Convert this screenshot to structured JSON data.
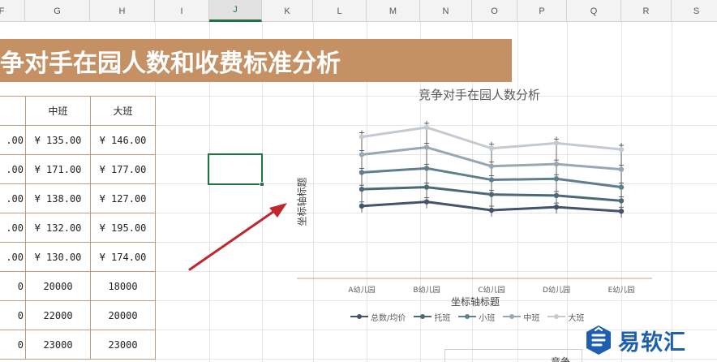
{
  "columns": [
    "F",
    "G",
    "H",
    "I",
    "J",
    "K",
    "L",
    "M",
    "N",
    "O",
    "P",
    "Q",
    "R",
    "S"
  ],
  "selected_column": "J",
  "banner_title": "争对手在园人数和收费标准分析",
  "table": {
    "headers": [
      "",
      "中班",
      "大班"
    ],
    "rows": [
      [
        ".00",
        "¥ 135.00",
        "¥ 146.00"
      ],
      [
        ".00",
        "¥ 171.00",
        "¥ 177.00"
      ],
      [
        ".00",
        "¥ 138.00",
        "¥ 127.00"
      ],
      [
        ".00",
        "¥ 132.00",
        "¥ 195.00"
      ],
      [
        ".00",
        "¥ 130.00",
        "¥ 174.00"
      ],
      [
        "0",
        "20000",
        "18000"
      ],
      [
        "0",
        "22000",
        "20000"
      ],
      [
        "0",
        "23000",
        "23000"
      ]
    ]
  },
  "chart_data": {
    "type": "line",
    "title": "竞争对手在园人数分析",
    "xlabel": "坐标轴标题",
    "ylabel": "坐标轴标题",
    "categories": [
      "A幼儿园",
      "B幼儿园",
      "C幼儿园",
      "D幼儿园",
      "E幼儿园"
    ],
    "series": [
      {
        "name": "总数/均价",
        "color": "#44546a",
        "values": [
          2.8,
          3.2,
          2.4,
          2.7,
          2.3
        ]
      },
      {
        "name": "托班",
        "color": "#4d6978",
        "values": [
          4.4,
          4.6,
          3.9,
          3.8,
          3.3
        ]
      },
      {
        "name": "小班",
        "color": "#5f7f8e",
        "values": [
          6.0,
          6.4,
          5.3,
          5.4,
          4.6
        ]
      },
      {
        "name": "中班",
        "color": "#97a8b4",
        "values": [
          7.7,
          8.4,
          6.6,
          6.8,
          6.3
        ]
      },
      {
        "name": "大班",
        "color": "#c3cad1",
        "values": [
          9.4,
          10.3,
          8.3,
          8.8,
          8.2
        ]
      }
    ],
    "error_bars": true,
    "legend_position": "bottom"
  },
  "logo": {
    "text": "易软汇",
    "color": "#1e5fb0"
  },
  "bottom_box_label": "竞争"
}
